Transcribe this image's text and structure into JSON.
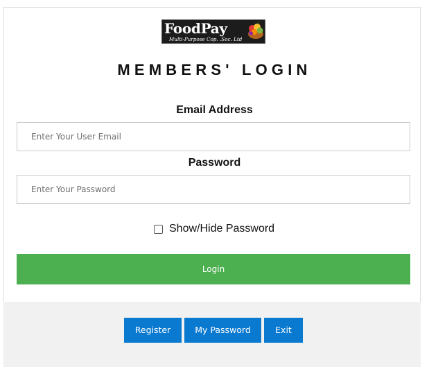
{
  "logo": {
    "brand": "FoodPay",
    "tagline": "Multi-Purpose Cop. .Soc. Ltd",
    "icon": "fruit-basket-icon"
  },
  "title": "MEMBERS' LOGIN",
  "email": {
    "label": "Email Address",
    "placeholder": "Enter Your User Email",
    "value": ""
  },
  "password": {
    "label": "Password",
    "placeholder": "Enter Your Password",
    "value": ""
  },
  "show_hide": {
    "label": "Show/Hide Password",
    "checked": false
  },
  "login_button": "Login",
  "footer_buttons": {
    "register": "Register",
    "my_password": "My Password",
    "exit": "Exit"
  },
  "colors": {
    "login_button": "#4caf50",
    "footer_buttons": "#0a7ad1",
    "footer_background": "#f1f1f1"
  }
}
